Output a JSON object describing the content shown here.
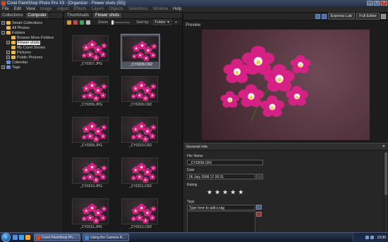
{
  "window": {
    "title": "Corel PaintShop Photo Pro X3 - [Organizer - Flower shots (55)]",
    "controls": [
      "_",
      "□",
      "×"
    ]
  },
  "menu": [
    "File",
    "Edit",
    "View",
    "Image",
    "Adjust",
    "Effects",
    "Layers",
    "Objects",
    "Selections",
    "Window",
    "Help"
  ],
  "left_panel": {
    "tabs": [
      "Collections",
      "Computer"
    ],
    "active_tab": "Computer",
    "tree": [
      {
        "label": "Smart Collections",
        "level": 0,
        "expander": "+",
        "icon": "folder"
      },
      {
        "label": "All Photos",
        "level": 0,
        "expander": "",
        "icon": "folder"
      },
      {
        "label": "Folders",
        "level": 0,
        "expander": "−",
        "icon": "folder"
      },
      {
        "label": "Browse More Folders",
        "level": 1,
        "expander": "",
        "icon": "folder"
      },
      {
        "label": "Flower shots",
        "level": 1,
        "expander": "+",
        "icon": "folder",
        "selected": true
      },
      {
        "label": "My Corel Shows",
        "level": 1,
        "expander": "",
        "icon": "folder"
      },
      {
        "label": "Pictures",
        "level": 1,
        "expander": "+",
        "icon": "folder"
      },
      {
        "label": "Public Pictures",
        "level": 1,
        "expander": "+",
        "icon": "folder"
      },
      {
        "label": "Calendar",
        "level": 0,
        "expander": "",
        "icon": "folder-blue"
      },
      {
        "label": "Tags",
        "level": 0,
        "expander": "+",
        "icon": "folder-blue"
      }
    ]
  },
  "thumb_panel": {
    "tabs": [
      "Thumbnails",
      "Flower shots"
    ],
    "active_tab": "Flower shots",
    "zoom_label": "Zoom",
    "sort_label": "Sort by :",
    "sort_value": "Folder",
    "thumbnails": [
      {
        "name": "_CY0207.JPG",
        "selected": false
      },
      {
        "name": "_CY0208.CR2",
        "selected": true
      },
      {
        "name": "_CY0209.JPG",
        "selected": false
      },
      {
        "name": "_CY0209.CR2",
        "selected": false
      },
      {
        "name": "_CY0209.JPG",
        "selected": false
      },
      {
        "name": "_CY0210.CR2",
        "selected": false
      },
      {
        "name": "_CY0210.JPG",
        "selected": false
      },
      {
        "name": "_CY0211.CR2",
        "selected": false
      },
      {
        "name": "_CY0211.JPG",
        "selected": false
      },
      {
        "name": "_CY0212.CR2",
        "selected": false
      }
    ]
  },
  "right_panel": {
    "express_lab": "Express Lab",
    "full_editor": "Full Editor",
    "preview_label": "Preview"
  },
  "info": {
    "title": "General Info",
    "file_name_label": "File Name",
    "file_name": "_CY0208.CR2",
    "date_label": "Date",
    "date": "06 July 2008 17:26:31",
    "rating_label": "Rating",
    "rating_max": 5,
    "rating_value": 0,
    "tags_label": "Tags",
    "tags_placeholder": "Type here to add a tag"
  },
  "taskbar": {
    "tasks": [
      {
        "label": "Corel PaintShop Ph...",
        "icon_color": "#d04a1a",
        "active": true
      },
      {
        "label": "Using the Camera R...",
        "icon_color": "#3a8ad0",
        "active": false
      }
    ],
    "clock": "13:30"
  },
  "colors": {
    "accent_pink": "#e0208a",
    "orchid_center": "#f2d23a",
    "selection": "#4f5561"
  }
}
